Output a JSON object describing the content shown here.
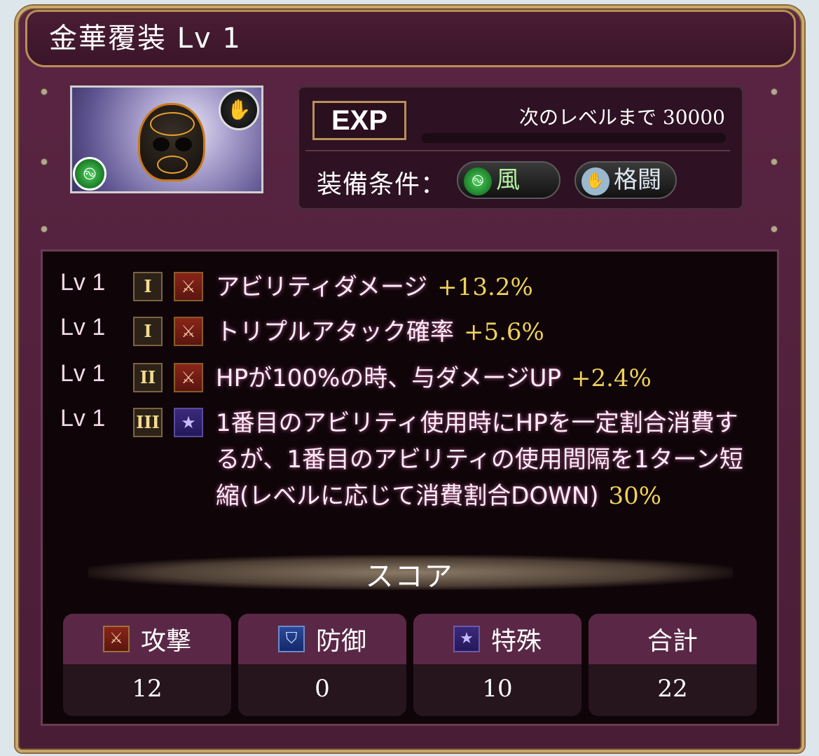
{
  "title": "金華覆装 Lv 1",
  "item": {
    "element_icon": "wind-element-icon",
    "weapon_icon": "glove-icon"
  },
  "exp": {
    "label": "EXP",
    "next_level_label": "次のレベルまで",
    "next_level_value": "30000",
    "progress_fraction": 0.0
  },
  "requirements": {
    "label": "装備条件：",
    "element": "風",
    "weapon": "格闘"
  },
  "skills": [
    {
      "lv": "Lv 1",
      "tier": "I",
      "type": "attack",
      "text": "アビリティダメージ",
      "value": "+13.2%"
    },
    {
      "lv": "Lv 1",
      "tier": "I",
      "type": "attack",
      "text": "トリプルアタック確率",
      "value": "+5.6%"
    },
    {
      "lv": "Lv 1",
      "tier": "II",
      "type": "attack",
      "text": "HPが100%の時、与ダメージUP",
      "value": "+2.4%"
    },
    {
      "lv": "Lv 1",
      "tier": "III",
      "type": "special",
      "text": "1番目のアビリティ使用時にHPを一定割合消費するが、1番目のアビリティの使用間隔を1ターン短縮(レベルに応じて消費割合DOWN)",
      "value": "30%"
    }
  ],
  "score": {
    "title": "スコア",
    "attack_label": "攻撃",
    "attack_value": "12",
    "defense_label": "防御",
    "defense_value": "0",
    "special_label": "特殊",
    "special_value": "10",
    "total_label": "合計",
    "total_value": "22"
  },
  "colors": {
    "panel": "#4a1d36",
    "gold_border": "#c9a86a",
    "value_gold": "#f0d25a",
    "dark": "#0f0509"
  }
}
